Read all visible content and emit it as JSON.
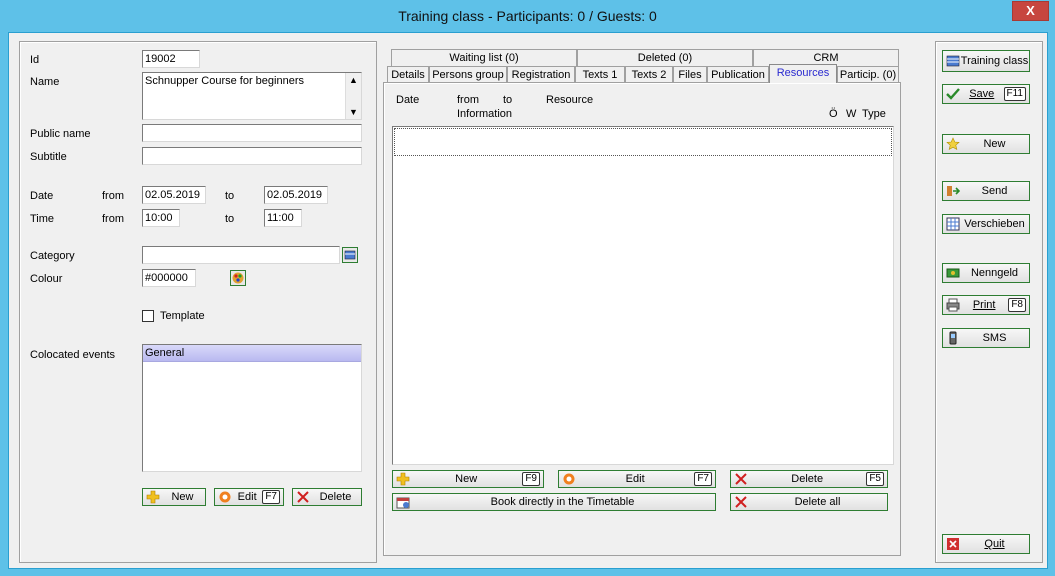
{
  "window": {
    "title": "Training class - Participants: 0 / Guests: 0",
    "close_glyph": "X"
  },
  "form": {
    "id": {
      "label": "Id",
      "value": "19002"
    },
    "name": {
      "label": "Name",
      "value": "Schnupper Course for beginners"
    },
    "public_name": {
      "label": "Public name",
      "value": ""
    },
    "subtitle": {
      "label": "Subtitle",
      "value": ""
    },
    "date": {
      "label": "Date",
      "from_label": "from",
      "from": "02.05.2019",
      "to_label": "to",
      "to": "02.05.2019"
    },
    "time": {
      "label": "Time",
      "from_label": "from",
      "from": "10:00",
      "to_label": "to",
      "to": "11:00"
    },
    "category": {
      "label": "Category",
      "value": ""
    },
    "colour": {
      "label": "Colour",
      "value": "#000000"
    },
    "template": {
      "label": "Template",
      "checked": false
    },
    "colocated": {
      "label": "Colocated events",
      "items": [
        "General"
      ]
    },
    "buttons": {
      "new": "New",
      "edit": "Edit",
      "edit_key": "F7",
      "delete": "Delete"
    }
  },
  "tabs": {
    "row1": [
      "Waiting list (0)",
      "Deleted (0)",
      "CRM"
    ],
    "row2": [
      "Details",
      "Persons group",
      "Registration",
      "Texts 1",
      "Texts 2",
      "Files",
      "Publication",
      "Resources",
      "Particip. (0)"
    ],
    "active": "Resources"
  },
  "resources": {
    "headers": {
      "date": "Date",
      "from": "from",
      "to": "to",
      "resource": "Resource",
      "information": "Information",
      "o": "Ö",
      "w": "W",
      "type": "Type"
    },
    "buttons": {
      "new": "New",
      "new_key": "F9",
      "edit": "Edit",
      "edit_key": "F7",
      "delete": "Delete",
      "delete_key": "F5",
      "book": "Book directly in the Timetable",
      "delete_all": "Delete all"
    }
  },
  "sidebar": {
    "training_class": "Training class",
    "save": "Save",
    "save_key": "F11",
    "new": "New",
    "send": "Send",
    "verschieben": "Verschieben",
    "nenngeld": "Nenngeld",
    "print": "Print",
    "print_key": "F8",
    "sms": "SMS",
    "quit": "Quit"
  },
  "colors": {
    "title_bar": "#5ec1e8",
    "close": "#c7463f",
    "selection": "#c8c8f8",
    "active_tab_text": "#2a2ad0"
  }
}
